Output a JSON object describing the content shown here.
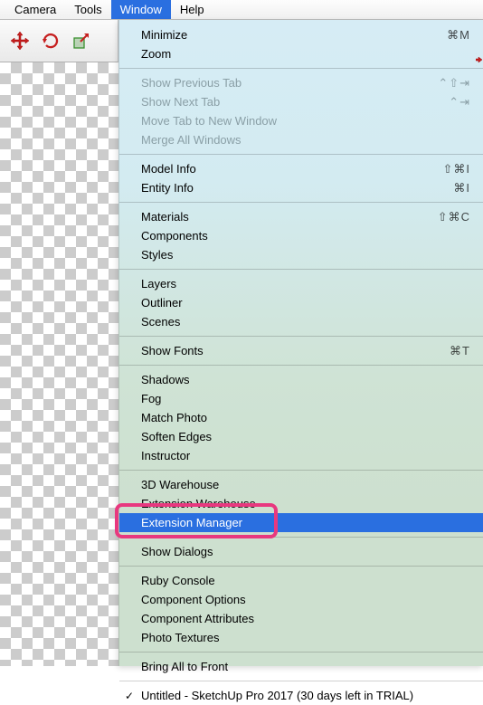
{
  "menubar": {
    "items": [
      {
        "label": "Camera",
        "active": false
      },
      {
        "label": "Tools",
        "active": false
      },
      {
        "label": "Window",
        "active": true
      },
      {
        "label": "Help",
        "active": false
      }
    ]
  },
  "toolbar": {
    "icons": [
      "move-icon",
      "rotate-icon",
      "scale-icon"
    ]
  },
  "dropdown": {
    "groups": [
      [
        {
          "label": "Minimize",
          "shortcut": "⌘M",
          "disabled": false
        },
        {
          "label": "Zoom",
          "shortcut": "",
          "disabled": false
        }
      ],
      [
        {
          "label": "Show Previous Tab",
          "shortcut": "⌃⇧⇥",
          "disabled": true
        },
        {
          "label": "Show Next Tab",
          "shortcut": "⌃⇥",
          "disabled": true
        },
        {
          "label": "Move Tab to New Window",
          "shortcut": "",
          "disabled": true
        },
        {
          "label": "Merge All Windows",
          "shortcut": "",
          "disabled": true
        }
      ],
      [
        {
          "label": "Model Info",
          "shortcut": "⇧⌘I",
          "disabled": false
        },
        {
          "label": "Entity Info",
          "shortcut": "⌘I",
          "disabled": false
        }
      ],
      [
        {
          "label": "Materials",
          "shortcut": "⇧⌘C",
          "disabled": false
        },
        {
          "label": "Components",
          "shortcut": "",
          "disabled": false
        },
        {
          "label": "Styles",
          "shortcut": "",
          "disabled": false
        }
      ],
      [
        {
          "label": "Layers",
          "shortcut": "",
          "disabled": false
        },
        {
          "label": "Outliner",
          "shortcut": "",
          "disabled": false
        },
        {
          "label": "Scenes",
          "shortcut": "",
          "disabled": false
        }
      ],
      [
        {
          "label": "Show Fonts",
          "shortcut": "⌘T",
          "disabled": false
        }
      ],
      [
        {
          "label": "Shadows",
          "shortcut": "",
          "disabled": false
        },
        {
          "label": "Fog",
          "shortcut": "",
          "disabled": false
        },
        {
          "label": "Match Photo",
          "shortcut": "",
          "disabled": false
        },
        {
          "label": "Soften Edges",
          "shortcut": "",
          "disabled": false
        },
        {
          "label": "Instructor",
          "shortcut": "",
          "disabled": false
        }
      ],
      [
        {
          "label": "3D Warehouse",
          "shortcut": "",
          "disabled": false
        },
        {
          "label": "Extension Warehouse",
          "shortcut": "",
          "disabled": false
        },
        {
          "label": "Extension Manager",
          "shortcut": "",
          "disabled": false,
          "selected": true
        }
      ],
      [
        {
          "label": "Show Dialogs",
          "shortcut": "",
          "disabled": false
        }
      ],
      [
        {
          "label": "Ruby Console",
          "shortcut": "",
          "disabled": false
        },
        {
          "label": "Component Options",
          "shortcut": "",
          "disabled": false
        },
        {
          "label": "Component Attributes",
          "shortcut": "",
          "disabled": false
        },
        {
          "label": "Photo Textures",
          "shortcut": "",
          "disabled": false
        }
      ],
      [
        {
          "label": "Bring All to Front",
          "shortcut": "",
          "disabled": false
        }
      ],
      [
        {
          "label": "Untitled - SketchUp Pro 2017 (30 days left in TRIAL)",
          "shortcut": "",
          "disabled": false,
          "checked": true
        }
      ]
    ]
  },
  "highlight": {
    "target_label": "Extension Manager"
  }
}
